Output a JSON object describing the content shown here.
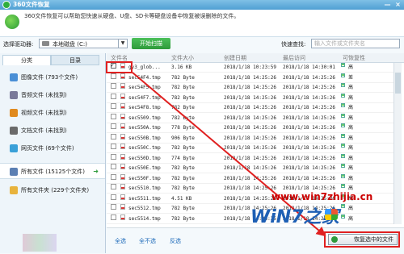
{
  "window": {
    "title": "360文件恢复",
    "min": "—",
    "close": "×"
  },
  "banner": {
    "description": "360文件恢复可以帮助您快速从硬盘、U盘、SD卡等硬盘设备中恢复被误删除的文件。"
  },
  "toolbar": {
    "drive_label": "选择驱动器:",
    "drive_value": "本地磁盘 (C:)",
    "scan_button": "开始扫描",
    "quick_label": "快速查找:",
    "quick_placeholder": "输入文件或文件夹名"
  },
  "sidebar": {
    "tabs": [
      "分类",
      "目录"
    ],
    "items": [
      {
        "label": "图像文件 (793个文件)",
        "color": "#4a8fd6"
      },
      {
        "label": "音频文件 (未找到)",
        "color": "#7a7a9a"
      },
      {
        "label": "视频文件 (未找到)",
        "color": "#e08a1e"
      },
      {
        "label": "文档文件 (未找到)",
        "color": "#6a6a6a"
      },
      {
        "label": "网页文件 (69个文件)",
        "color": "#3aa0d8"
      },
      {
        "label": "所有文件 (15125个文件)",
        "color": "#5b7fb3"
      },
      {
        "label": "所有文件夹 (229个文件夹)",
        "color": "#e8b33c"
      }
    ],
    "selected_index": 5
  },
  "table": {
    "headers": [
      "文件名",
      "文件大小",
      "创建日期",
      "最后访问",
      "可恢复性"
    ],
    "rows": [
      {
        "checked": true,
        "name": "gv3_glob...",
        "size": "3.16 KB",
        "created": "2018/1/18 10:23:59",
        "accessed": "2018/1/18 14:30:01",
        "rec": "高"
      },
      {
        "checked": false,
        "name": "sec54F4.tmp",
        "size": "782 Byte",
        "created": "2018/1/18 14:25:26",
        "accessed": "2018/1/18 14:25:26",
        "rec": "差"
      },
      {
        "checked": false,
        "name": "sec54F5.tmp",
        "size": "782 Byte",
        "created": "2018/1/18 14:25:26",
        "accessed": "2018/1/18 14:25:26",
        "rec": "高"
      },
      {
        "checked": false,
        "name": "sec54F7.tmp",
        "size": "782 Byte",
        "created": "2018/1/18 14:25:26",
        "accessed": "2018/1/18 14:25:26",
        "rec": "高"
      },
      {
        "checked": false,
        "name": "sec54F8.tmp",
        "size": "782 Byte",
        "created": "2018/1/18 14:25:26",
        "accessed": "2018/1/18 14:25:26",
        "rec": "高"
      },
      {
        "checked": false,
        "name": "sec5509.tmp",
        "size": "782 Byte",
        "created": "2018/1/18 14:25:26",
        "accessed": "2018/1/18 14:25:26",
        "rec": "高"
      },
      {
        "checked": false,
        "name": "sec550A.tmp",
        "size": "778 Byte",
        "created": "2018/1/18 14:25:26",
        "accessed": "2018/1/18 14:25:26",
        "rec": "高"
      },
      {
        "checked": false,
        "name": "sec550B.tmp",
        "size": "906 Byte",
        "created": "2018/1/18 14:25:26",
        "accessed": "2018/1/18 14:25:26",
        "rec": "高"
      },
      {
        "checked": false,
        "name": "sec550C.tmp",
        "size": "782 Byte",
        "created": "2018/1/18 14:25:26",
        "accessed": "2018/1/18 14:25:26",
        "rec": "高"
      },
      {
        "checked": false,
        "name": "sec550D.tmp",
        "size": "774 Byte",
        "created": "2018/1/18 14:25:26",
        "accessed": "2018/1/18 14:25:26",
        "rec": "高"
      },
      {
        "checked": false,
        "name": "sec550E.tmp",
        "size": "782 Byte",
        "created": "2018/1/18 14:25:26",
        "accessed": "2018/1/18 14:25:26",
        "rec": "高"
      },
      {
        "checked": false,
        "name": "sec550F.tmp",
        "size": "782 Byte",
        "created": "2018/1/18 14:25:26",
        "accessed": "2018/1/18 14:25:26",
        "rec": "高"
      },
      {
        "checked": false,
        "name": "sec5510.tmp",
        "size": "782 Byte",
        "created": "2018/1/18 14:25:26",
        "accessed": "2018/1/18 14:25:26",
        "rec": "高"
      },
      {
        "checked": false,
        "name": "sec5511.tmp",
        "size": "4.51 KB",
        "created": "2018/1/18 14:25:26",
        "accessed": "2018/1/18 14:25:26",
        "rec": "高"
      },
      {
        "checked": false,
        "name": "sec5512.tmp",
        "size": "782 Byte",
        "created": "2018/1/18 14:25:26",
        "accessed": "2018/1/18 14:25:26",
        "rec": "高"
      },
      {
        "checked": false,
        "name": "sec5514.tmp",
        "size": "782 Byte",
        "created": "2018/1/18 14:25:26",
        "accessed": "2018/1/18 14:25:26",
        "rec": "高"
      }
    ]
  },
  "footer": {
    "select_all": "全选",
    "select_none": "全不选",
    "invert": "反选",
    "recover_button": "恢复选中的文件"
  },
  "watermark": {
    "site": "www.win7zhijia.cn",
    "brand": "WiN7之家"
  },
  "colors": {
    "accent_green": "#2e9a3b",
    "highlight_red": "#e02020",
    "title_blue": "#4f9fd3"
  }
}
